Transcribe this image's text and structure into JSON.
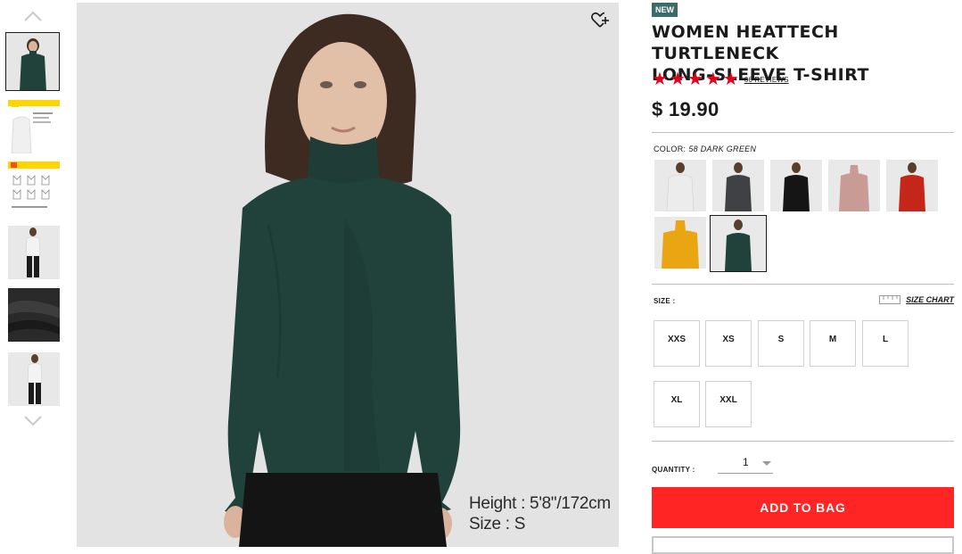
{
  "thumbnails": [
    {
      "name": "thumb-green-turtleneck"
    },
    {
      "name": "thumb-product-card-white"
    },
    {
      "name": "thumb-size-guide"
    },
    {
      "name": "thumb-model-white-full"
    },
    {
      "name": "thumb-fabric-detail"
    },
    {
      "name": "thumb-model-white-full-2"
    }
  ],
  "main_image": {
    "model_height": "Height : 5'8\"/172cm",
    "model_size": "Size : S"
  },
  "product": {
    "badge": "NEW",
    "title_line1": "WOMEN HEATTECH TURTLENECK",
    "title_line2": "LONG-SLEEVE T-SHIRT",
    "rating_stars": 5,
    "reviews": "66 REVIEWS",
    "price": "$ 19.90"
  },
  "color": {
    "label": "COLOR:",
    "selected": "58 DARK GREEN",
    "swatches": [
      {
        "hex": "#ececec"
      },
      {
        "hex": "#3f4144"
      },
      {
        "hex": "#151515"
      },
      {
        "hex": "#c99b95"
      },
      {
        "hex": "#c5261a"
      },
      {
        "hex": "#e9a612"
      },
      {
        "hex": "#21423a"
      }
    ]
  },
  "size": {
    "label": "SIZE :",
    "chart_label": "SIZE CHART",
    "options": [
      "XXS",
      "XS",
      "S",
      "M",
      "L",
      "XL",
      "XXL"
    ]
  },
  "quantity": {
    "label": "QUANTITY :",
    "value": "1"
  },
  "cart": {
    "add_label": "ADD TO BAG"
  },
  "colors": {
    "accent_red": "#ff2525",
    "star_red": "#e5001b",
    "badge_teal": "#3d6b6a",
    "garment_green": "#21423a"
  }
}
